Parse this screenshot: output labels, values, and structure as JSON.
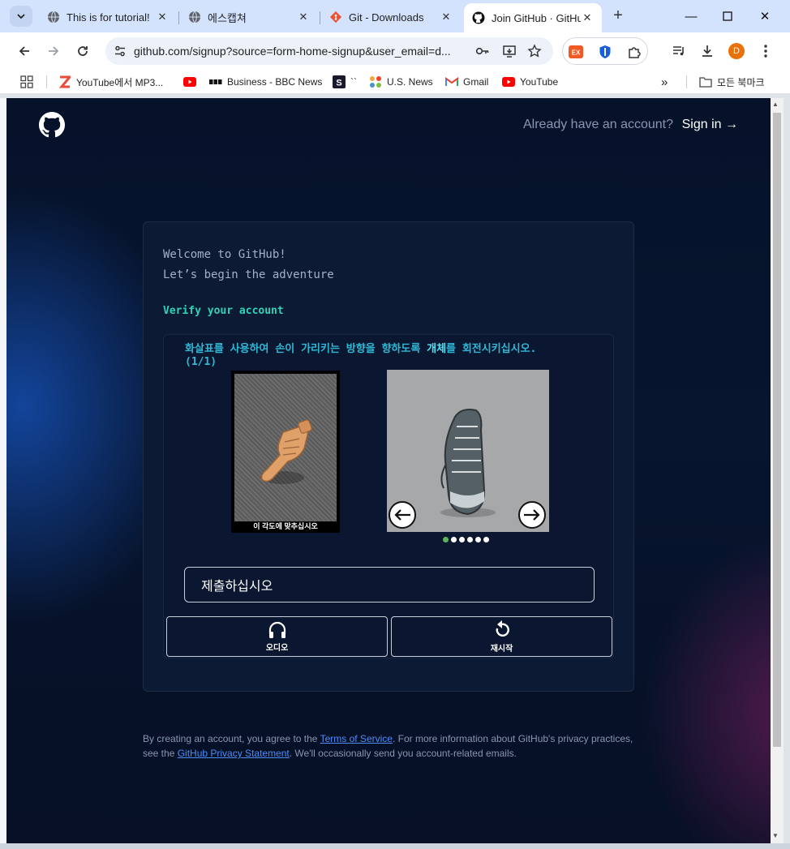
{
  "browser": {
    "tabs": [
      {
        "title": "This is for tutorial!",
        "icon": "globe-icon"
      },
      {
        "title": "에스캡쳐",
        "icon": "globe-icon"
      },
      {
        "title": "Git - Downloads",
        "icon": "git-icon"
      },
      {
        "title": "Join GitHub · GitHu",
        "icon": "github-icon",
        "active": true
      }
    ],
    "url": "github.com/signup?source=form-home-signup&user_email=d...",
    "profile_initial": "D",
    "bookmarks": [
      {
        "label": "YouTube에서 MP3...",
        "icon": "z-icon"
      },
      {
        "label": "",
        "icon": "youtube-icon"
      },
      {
        "label": "Business - BBC News",
        "icon": "bbc-icon"
      },
      {
        "label": "``",
        "icon": "s-icon"
      },
      {
        "label": "U.S. News",
        "icon": "joomla-icon"
      },
      {
        "label": "Gmail",
        "icon": "gmail-icon"
      },
      {
        "label": "YouTube",
        "icon": "youtube-icon"
      }
    ],
    "all_bookmarks": "모든 북마크"
  },
  "header": {
    "have_account": "Already have an account?",
    "sign_in": "Sign in →"
  },
  "card": {
    "welcome_line1": "Welcome to GitHub!",
    "welcome_line2": "Let’s begin the adventure",
    "verify_title": "Verify your account",
    "captcha": {
      "instruction_part1": "화살표를 사용하여 손이 가리키는 방향을 향하도록 ",
      "instruction_highlight": "개체",
      "instruction_part2": "를 회전시키십시오.",
      "instruction_counter": "(1/1)",
      "reference_caption": "이 각도에 맞추십시오",
      "dots_total": 6,
      "dot_active": 1,
      "submit_label": "제출하십시오",
      "audio_label": "오디오",
      "restart_label": "재시작"
    }
  },
  "legal": {
    "prefix": "By creating an account, you agree to the ",
    "terms_link": "Terms of Service",
    "middle": ". For more information about GitHub's privacy practices, see the ",
    "privacy_link": "GitHub Privacy Statement",
    "suffix": ". We'll occasionally send you account-related emails."
  },
  "colors": {
    "accent_green": "#2fd3b8",
    "instruction_cyan": "#2fb8d6",
    "link_blue": "#4c8df6",
    "page_bg": "#06122a"
  }
}
